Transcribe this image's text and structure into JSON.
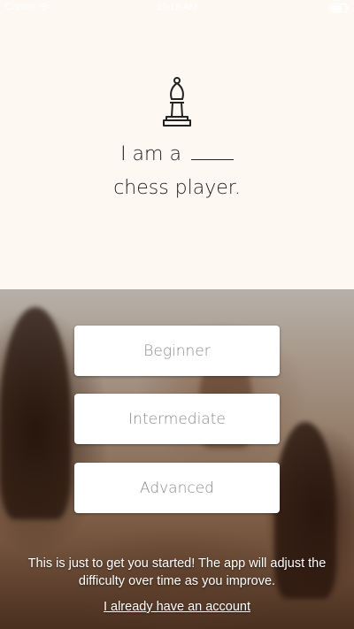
{
  "status_bar": {
    "carrier": "Carrier",
    "time": "10:16 AM",
    "wifi_icon": "wifi-icon",
    "battery_icon": "battery-icon"
  },
  "onboarding": {
    "icon": "bishop-icon",
    "headline_line1": "I am a",
    "headline_line2": "chess player."
  },
  "skill_levels": [
    {
      "label": "Beginner"
    },
    {
      "label": "Intermediate"
    },
    {
      "label": "Advanced"
    }
  ],
  "info_text": "This is just to get you started! The app will adjust the difficulty over time as you improve.",
  "login_link": "I already have an account",
  "colors": {
    "top_background": "#fdf8f2",
    "text_dark": "#222222",
    "button_text": "#8a8a8a",
    "button_background": "#ffffff"
  }
}
